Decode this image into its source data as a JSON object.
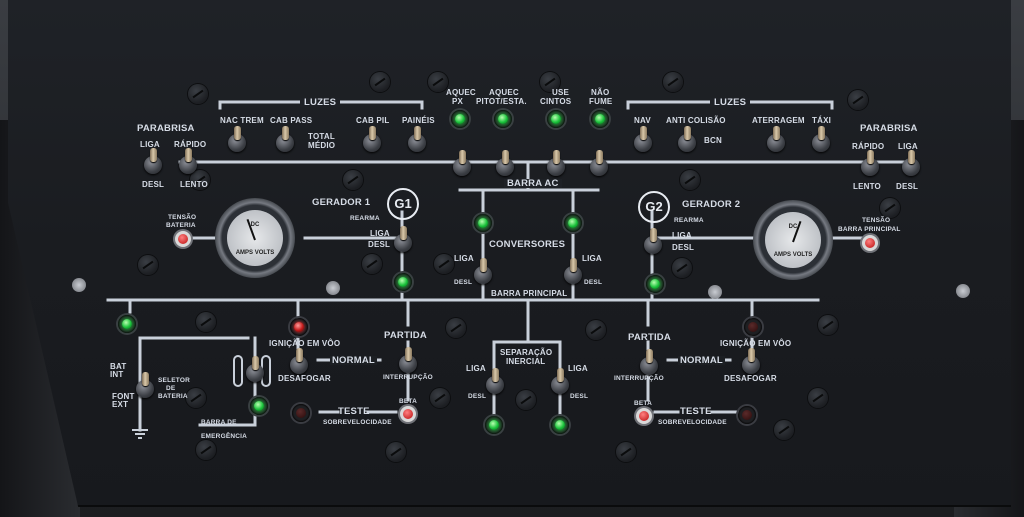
{
  "labels": {
    "luzes_left": "LUZES",
    "luzes_right": "LUZES",
    "parabrisa_left": "PARABRISA",
    "parabrisa_right": "PARABRISA",
    "liga": "LIGA",
    "desl": "DESL",
    "rapido": "RÁPIDO",
    "lento": "LENTO",
    "nac_trem": "NAC TREM",
    "cab_pass": "CAB PASS",
    "total_medio_1": "TOTAL",
    "total_medio_2": "MÉDIO",
    "cab_pil": "CAB PIL",
    "paineis": "PAINÉIS",
    "aquec_px_1": "AQUEC",
    "aquec_px_2": "PX",
    "aquec_pitot_1": "AQUEC",
    "aquec_pitot_2": "PITOT/ESTA.",
    "use_cintos_1": "USE",
    "use_cintos_2": "CINTOS",
    "nao_fume_1": "NÃO",
    "nao_fume_2": "FUME",
    "nav": "NAV",
    "anti_colisao": "ANTI COLISÃO",
    "bcn": "BCN",
    "aterragem": "ATERRAGEM",
    "taxi": "TÁXI",
    "tensao_bateria_1": "TENSÃO",
    "tensao_bateria_2": "BATERIA",
    "tensao_barra_1": "TENSÃO",
    "tensao_barra_2": "BARRA PRINCIPAL",
    "gerador1": "GERADOR 1",
    "gerador2": "GERADOR 2",
    "g1": "G1",
    "g2": "G2",
    "rearma": "REARMA",
    "barra_ac": "BARRA AC",
    "conversores": "CONVERSORES",
    "barra_principal": "BARRA PRINCIPAL",
    "bat_int_1": "BAT",
    "bat_int_2": "INT",
    "font_ext_1": "FONT",
    "font_ext_2": "EXT",
    "seletor_1": "SELETOR",
    "seletor_2": "DE",
    "seletor_3": "BATERIA",
    "ignicao_em_voo": "IGNIÇÃO EM VÔO",
    "desafogar": "DESAFOGAR",
    "normal": "NORMAL",
    "partida": "PARTIDA",
    "interrupcao": "INTERRUPÇÃO",
    "separacao_1": "SEPARAÇÃO",
    "separacao_2": "INERCIAL",
    "barra_emerg_1": "BARRA DE",
    "barra_emerg_2": "EMERGÊNCIA",
    "teste": "TESTE",
    "sobrevelocidade": "SOBREVELOCIDADE",
    "beta": "BETA"
  },
  "gauge": {
    "dc": "DC",
    "amps_volts": "AMPS VOLTS"
  },
  "colors": {
    "wire": "#c9d0da",
    "lamp_green": "#19c23a",
    "lamp_red": "#c41a1a"
  }
}
